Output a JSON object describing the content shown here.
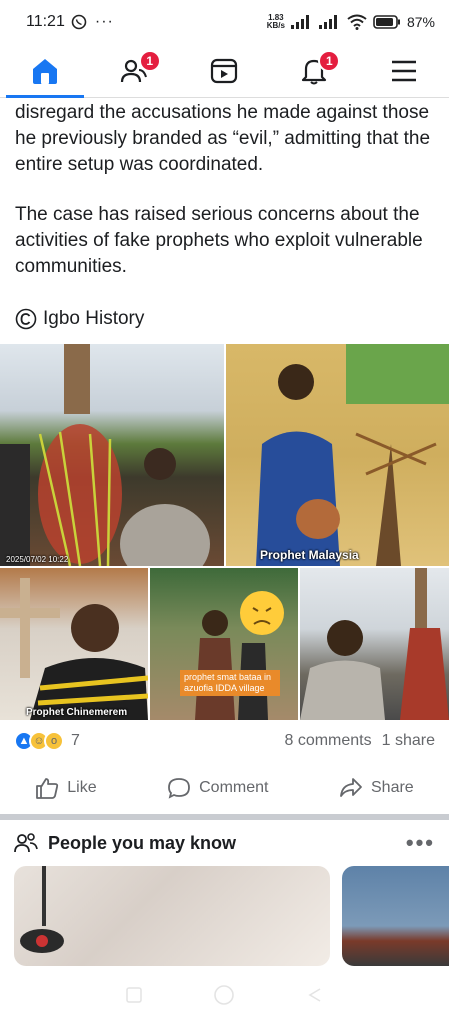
{
  "status_bar": {
    "time": "11:21",
    "speed_value": "1.83",
    "speed_unit": "KB/s",
    "battery": "87"
  },
  "nav": {
    "friends_badge": "1",
    "notifications_badge": "1"
  },
  "post": {
    "paragraphs": [
      "disregard the accusations he made against those he previously branded as “evil,” admitting that the entire setup was coordinated.",
      "The case has raised serious concerns about the activities of fake prophets who exploit vulnerable communities."
    ],
    "source": "Igbo History",
    "photo_captions": {
      "p1": "2025/07/02 10:22",
      "p2": "Prophet Malaysia",
      "p3": "Prophet Chinemerem",
      "p4": "prophet smat bataa in azuofia IDDA village"
    },
    "reaction_count": "7",
    "comments": "8 comments",
    "shares": "1 share",
    "actions": {
      "like": "Like",
      "comment": "Comment",
      "share": "Share"
    }
  },
  "pymk": {
    "title": "People you may know",
    "more": "•••"
  },
  "colors": {
    "accent": "#1877f2",
    "badge": "#e41e3f"
  }
}
